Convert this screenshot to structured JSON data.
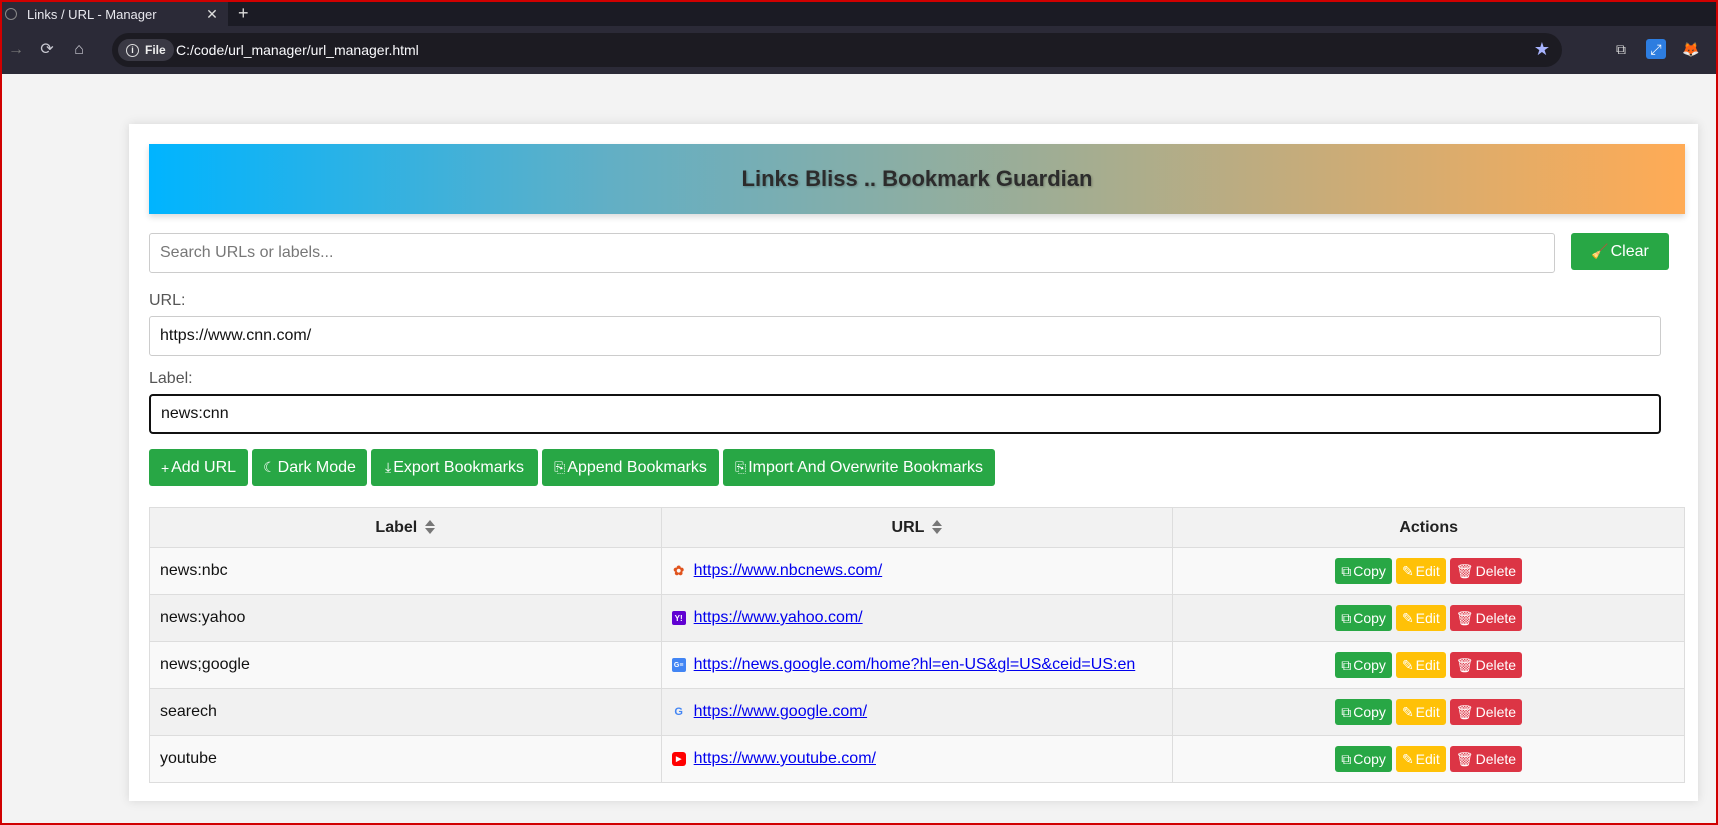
{
  "browser": {
    "tab_title": "Links / URL - Manager",
    "tab_close": "✕",
    "new_tab": "+",
    "site_info_label": "File",
    "address": "C:/code/url_manager/url_manager.html"
  },
  "app": {
    "title": "Links Bliss .. Bookmark Guardian",
    "search_placeholder": "Search URLs or labels...",
    "clear_label": "Clear",
    "url_label": "URL:",
    "url_value": "https://www.cnn.com/",
    "label_label": "Label:",
    "label_value": "news:cnn",
    "buttons": {
      "add_url": "Add URL",
      "dark_mode": "Dark Mode",
      "export": "Export Bookmarks",
      "append": "Append Bookmarks",
      "import_overwrite": "Import And Overwrite Bookmarks"
    }
  },
  "table": {
    "headers": {
      "label": "Label",
      "url": "URL",
      "actions": "Actions"
    },
    "action_labels": {
      "copy": "Copy",
      "edit": "Edit",
      "delete": "Delete"
    },
    "rows": [
      {
        "label": "news:nbc",
        "url": "https://www.nbcnews.com/",
        "icon": "nbc-icon"
      },
      {
        "label": "news:yahoo",
        "url": "https://www.yahoo.com/",
        "icon": "yahoo-icon"
      },
      {
        "label": "news;google",
        "url": "https://news.google.com/home?hl=en-US&gl=US&ceid=US:en",
        "icon": "google-news-icon"
      },
      {
        "label": "searech",
        "url": "https://www.google.com/",
        "icon": "google-icon"
      },
      {
        "label": "youtube",
        "url": "https://www.youtube.com/",
        "icon": "youtube-icon"
      }
    ]
  },
  "colors": {
    "green": "#28a745",
    "yellow": "#ffc107",
    "red": "#dc3545"
  }
}
